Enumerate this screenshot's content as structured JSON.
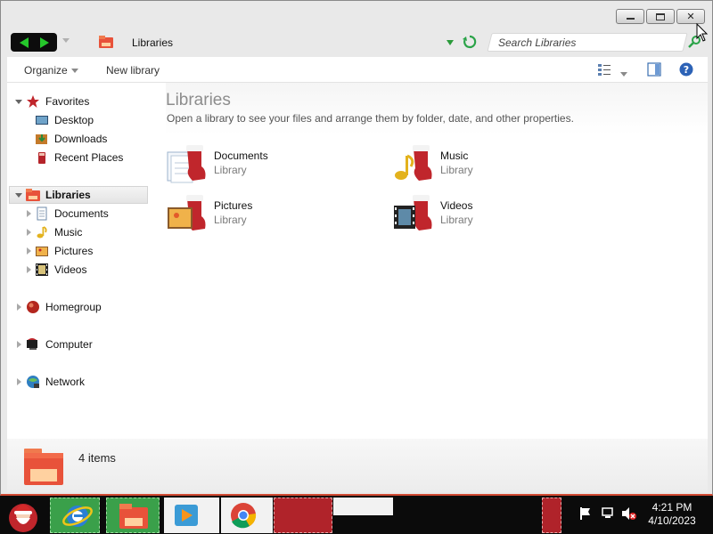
{
  "window": {
    "caption_buttons": {
      "minimize_icon": "minimize-icon",
      "maximize_icon": "maximize-icon",
      "close_glyph": "✕"
    }
  },
  "address_bar": {
    "back_icon": "back-arrow-icon",
    "forward_icon": "forward-arrow-icon",
    "location": "Libraries",
    "refresh_icon": "refresh-icon"
  },
  "search": {
    "placeholder": "Search Libraries",
    "icon": "search-icon"
  },
  "toolbar": {
    "organize_label": "Organize",
    "new_library_label": "New library",
    "view_icon": "change-view-icon",
    "preview_icon": "preview-pane-icon",
    "help_icon": "help-icon"
  },
  "nav": {
    "favorites": {
      "label": "Favorites",
      "items": [
        "Desktop",
        "Downloads",
        "Recent Places"
      ]
    },
    "libraries": {
      "label": "Libraries",
      "items": [
        "Documents",
        "Music",
        "Pictures",
        "Videos"
      ]
    },
    "homegroup": "Homegroup",
    "computer": "Computer",
    "network": "Network"
  },
  "main": {
    "title": "Libraries",
    "subtitle": "Open a library to see your files and arrange them by folder, date, and other properties.",
    "libraries": [
      {
        "name": "Documents",
        "type": "Library",
        "icon": "documents-library-icon"
      },
      {
        "name": "Music",
        "type": "Library",
        "icon": "music-library-icon"
      },
      {
        "name": "Pictures",
        "type": "Library",
        "icon": "pictures-library-icon"
      },
      {
        "name": "Videos",
        "type": "Library",
        "icon": "videos-library-icon"
      }
    ]
  },
  "details": {
    "count": "4 items"
  },
  "taskbar": {
    "clock_time": "4:21 PM",
    "clock_date": "4/10/2023",
    "colors": {
      "accent_red": "#b0232a",
      "accent_green": "#3aa04a"
    }
  }
}
